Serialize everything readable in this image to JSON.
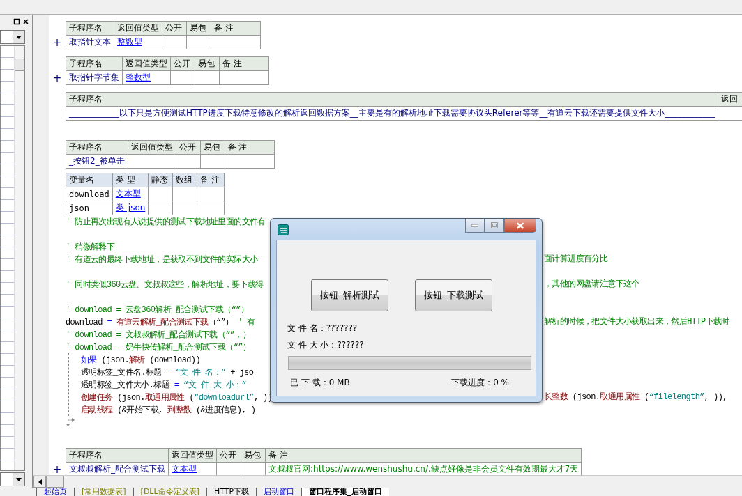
{
  "editor": {
    "blocks": [
      {
        "kind": "routine_table",
        "expander": "+",
        "columns": [
          "子程序名",
          "返回值类型",
          "公开",
          "易包",
          "备 注"
        ],
        "rows": [
          [
            {
              "kind": "name",
              "text": "取指针文本"
            },
            {
              "kind": "type",
              "text": "整数型"
            },
            {
              "kind": "empty"
            },
            {
              "kind": "empty"
            },
            {
              "kind": "empty"
            }
          ]
        ]
      },
      {
        "kind": "routine_table",
        "expander": "+",
        "columns": [
          "子程序名",
          "返回值类型",
          "公开",
          "易包",
          "备 注"
        ],
        "rows": [
          [
            {
              "kind": "name",
              "text": "取指针字节集"
            },
            {
              "kind": "type",
              "text": "整数型"
            },
            {
              "kind": "empty"
            },
            {
              "kind": "empty"
            },
            {
              "kind": "empty"
            }
          ]
        ]
      },
      {
        "kind": "routine_table",
        "columns": [
          "子程序名",
          "返回"
        ],
        "rows": [
          [
            {
              "kind": "name",
              "text": "____________以下只是方便测试HTTP进度下载特意修改的解析返回数据方案__主要是有的解析地址下载需要协议头Referer等等__有道云下载还需要提供文件大小____________"
            },
            {
              "kind": "empty"
            }
          ]
        ]
      },
      {
        "kind": "blank"
      },
      {
        "kind": "routine_table",
        "columns": [
          "子程序名",
          "返回值类型",
          "公开",
          "易包",
          "备 注"
        ],
        "rows": [
          [
            {
              "kind": "name",
              "text": "_按钮2_被单击"
            },
            {
              "kind": "empty"
            },
            {
              "kind": "empty"
            },
            {
              "kind": "empty"
            },
            {
              "kind": "empty"
            }
          ]
        ]
      },
      {
        "kind": "var_table",
        "columns": [
          "变量名",
          "类 型",
          "静态",
          "数组",
          "备 注"
        ],
        "rows": [
          [
            {
              "kind": "var",
              "text": "download"
            },
            {
              "kind": "type",
              "text": "文本型"
            },
            {
              "kind": "empty"
            },
            {
              "kind": "empty"
            },
            {
              "kind": "empty"
            }
          ],
          [
            {
              "kind": "var",
              "text": "json"
            },
            {
              "kind": "type",
              "text": "类_json"
            },
            {
              "kind": "empty"
            },
            {
              "kind": "empty"
            },
            {
              "kind": "empty"
            }
          ]
        ]
      },
      {
        "kind": "line",
        "left": [
          {
            "kind": "comment",
            "text": "' 防止再次出现有人说提供的测试下载地址里面的文件有"
          }
        ]
      },
      {
        "kind": "blank"
      },
      {
        "kind": "line",
        "left": [
          {
            "kind": "comment",
            "text": "' 稍微解释下"
          }
        ]
      },
      {
        "kind": "line",
        "left": [
          {
            "kind": "comment",
            "text": "' 有道云的最终下载地址，是获取不到文件的实际大小"
          }
        ],
        "right": [
          {
            "kind": "comment",
            "text": "面计算进度百分比"
          }
        ]
      },
      {
        "kind": "blank"
      },
      {
        "kind": "line",
        "left": [
          {
            "kind": "comment",
            "text": "' 同时类似360云盘、文叔叔这些，解析地址，要下载得"
          }
        ],
        "right": [
          {
            "kind": "comment",
            "text": "，其他的网盘请注意下这个"
          }
        ]
      },
      {
        "kind": "blank"
      },
      {
        "kind": "line",
        "left": [
          {
            "kind": "comment",
            "text": "' download = 云盘360解析_配合测试下载（“”）"
          }
        ]
      },
      {
        "kind": "line",
        "left": [
          {
            "kind": "plain",
            "text": "download "
          },
          {
            "kind": "flow",
            "text": "="
          },
          {
            "kind": "call",
            "text": " 有道云解析_配合测试下载"
          },
          {
            "kind": "plain",
            "text": "（“”） "
          },
          {
            "kind": "comment",
            "text": "' 有"
          }
        ],
        "right": [
          {
            "kind": "comment",
            "text": "解析的时候，把文件大小获取出来，然后HTTP下载时"
          }
        ]
      },
      {
        "kind": "line",
        "left": [
          {
            "kind": "comment",
            "text": "' download = 文叔叔解析_配合测试下载（“”，）"
          }
        ]
      },
      {
        "kind": "line",
        "left": [
          {
            "kind": "comment",
            "text": "' download = 奶牛快传解析_配合测试下载（“”）"
          }
        ]
      },
      {
        "kind": "if",
        "lines": [
          {
            "left": [
              {
                "kind": "flow",
                "text": "如果"
              },
              {
                "kind": "plain",
                "text": " (json."
              },
              {
                "kind": "call",
                "text": "解析"
              },
              {
                "kind": "plain",
                "text": " (download))"
              }
            ]
          },
          {
            "left": [
              {
                "kind": "plain",
                "text": "透明标签_文件名.标题 "
              },
              {
                "kind": "flow",
                "text": "="
              },
              {
                "kind": "string",
                "text": " “文 件 名：”"
              },
              {
                "kind": "plain",
                "text": " + jso"
              }
            ]
          },
          {
            "left": [
              {
                "kind": "plain",
                "text": "透明标签_文件大小.标题 "
              },
              {
                "kind": "flow",
                "text": "="
              },
              {
                "kind": "string",
                "text": " “文 件 大 小：”"
              }
            ]
          },
          {
            "left": [
              {
                "kind": "call",
                "text": "创建任务"
              },
              {
                "kind": "plain",
                "text": " (json."
              },
              {
                "kind": "call",
                "text": "取通用属性"
              },
              {
                "kind": "plain",
                "text": " ("
              },
              {
                "kind": "string",
                "text": "“downloadurl”"
              },
              {
                "kind": "plain",
                "text": ", ))"
              }
            ],
            "right": [
              {
                "kind": "call",
                "text": "长整数"
              },
              {
                "kind": "plain",
                "text": " (json."
              },
              {
                "kind": "call",
                "text": "取通用属性"
              },
              {
                "kind": "plain",
                "text": " ("
              },
              {
                "kind": "string",
                "text": "“filelength”"
              },
              {
                "kind": "plain",
                "text": ", )),"
              }
            ]
          },
          {
            "left": [
              {
                "kind": "call",
                "text": "启动线程"
              },
              {
                "kind": "plain",
                "text": " (&开始下载, "
              },
              {
                "kind": "call",
                "text": "到整数"
              },
              {
                "kind": "plain",
                "text": " (&进度信息), )"
              }
            ]
          }
        ]
      },
      {
        "kind": "blank"
      },
      {
        "kind": "routine_table",
        "expander": "+",
        "columns": [
          "子程序名",
          "返回值类型",
          "公开",
          "易包",
          "备 注"
        ],
        "rows": [
          [
            {
              "kind": "name",
              "text": "文叔叔解析_配合测试下载"
            },
            {
              "kind": "type",
              "text": "文本型"
            },
            {
              "kind": "empty"
            },
            {
              "kind": "empty"
            },
            {
              "kind": "note",
              "text": "文叔叔官网:https://www.wenshushu.cn/,缺点好像是非会员文件有效期最大才7天"
            }
          ]
        ]
      }
    ]
  },
  "dialog": {
    "buttons": [
      "按钮_解析测试",
      "按钮_下载测试"
    ],
    "file_name": "文 件 名：???????",
    "file_size": "文 件 大 小：??????",
    "progress": {
      "level": 0
    },
    "downloaded": "已 下 载：0 MB",
    "percent": "下载进度：0 %"
  },
  "tabs": [
    {
      "label": "起始页",
      "kind": "page",
      "selected": false
    },
    {
      "label": "[常用数据表]",
      "kind": "data",
      "selected": false
    },
    {
      "label": "[DLL命令定义表]",
      "kind": "data",
      "selected": false
    },
    {
      "label": "HTTP下载",
      "kind": "code",
      "selected": false
    },
    {
      "label": "启动窗口",
      "kind": "page",
      "selected": false
    },
    {
      "label": "窗口程序集_启动窗口",
      "kind": "code",
      "selected": true
    }
  ]
}
